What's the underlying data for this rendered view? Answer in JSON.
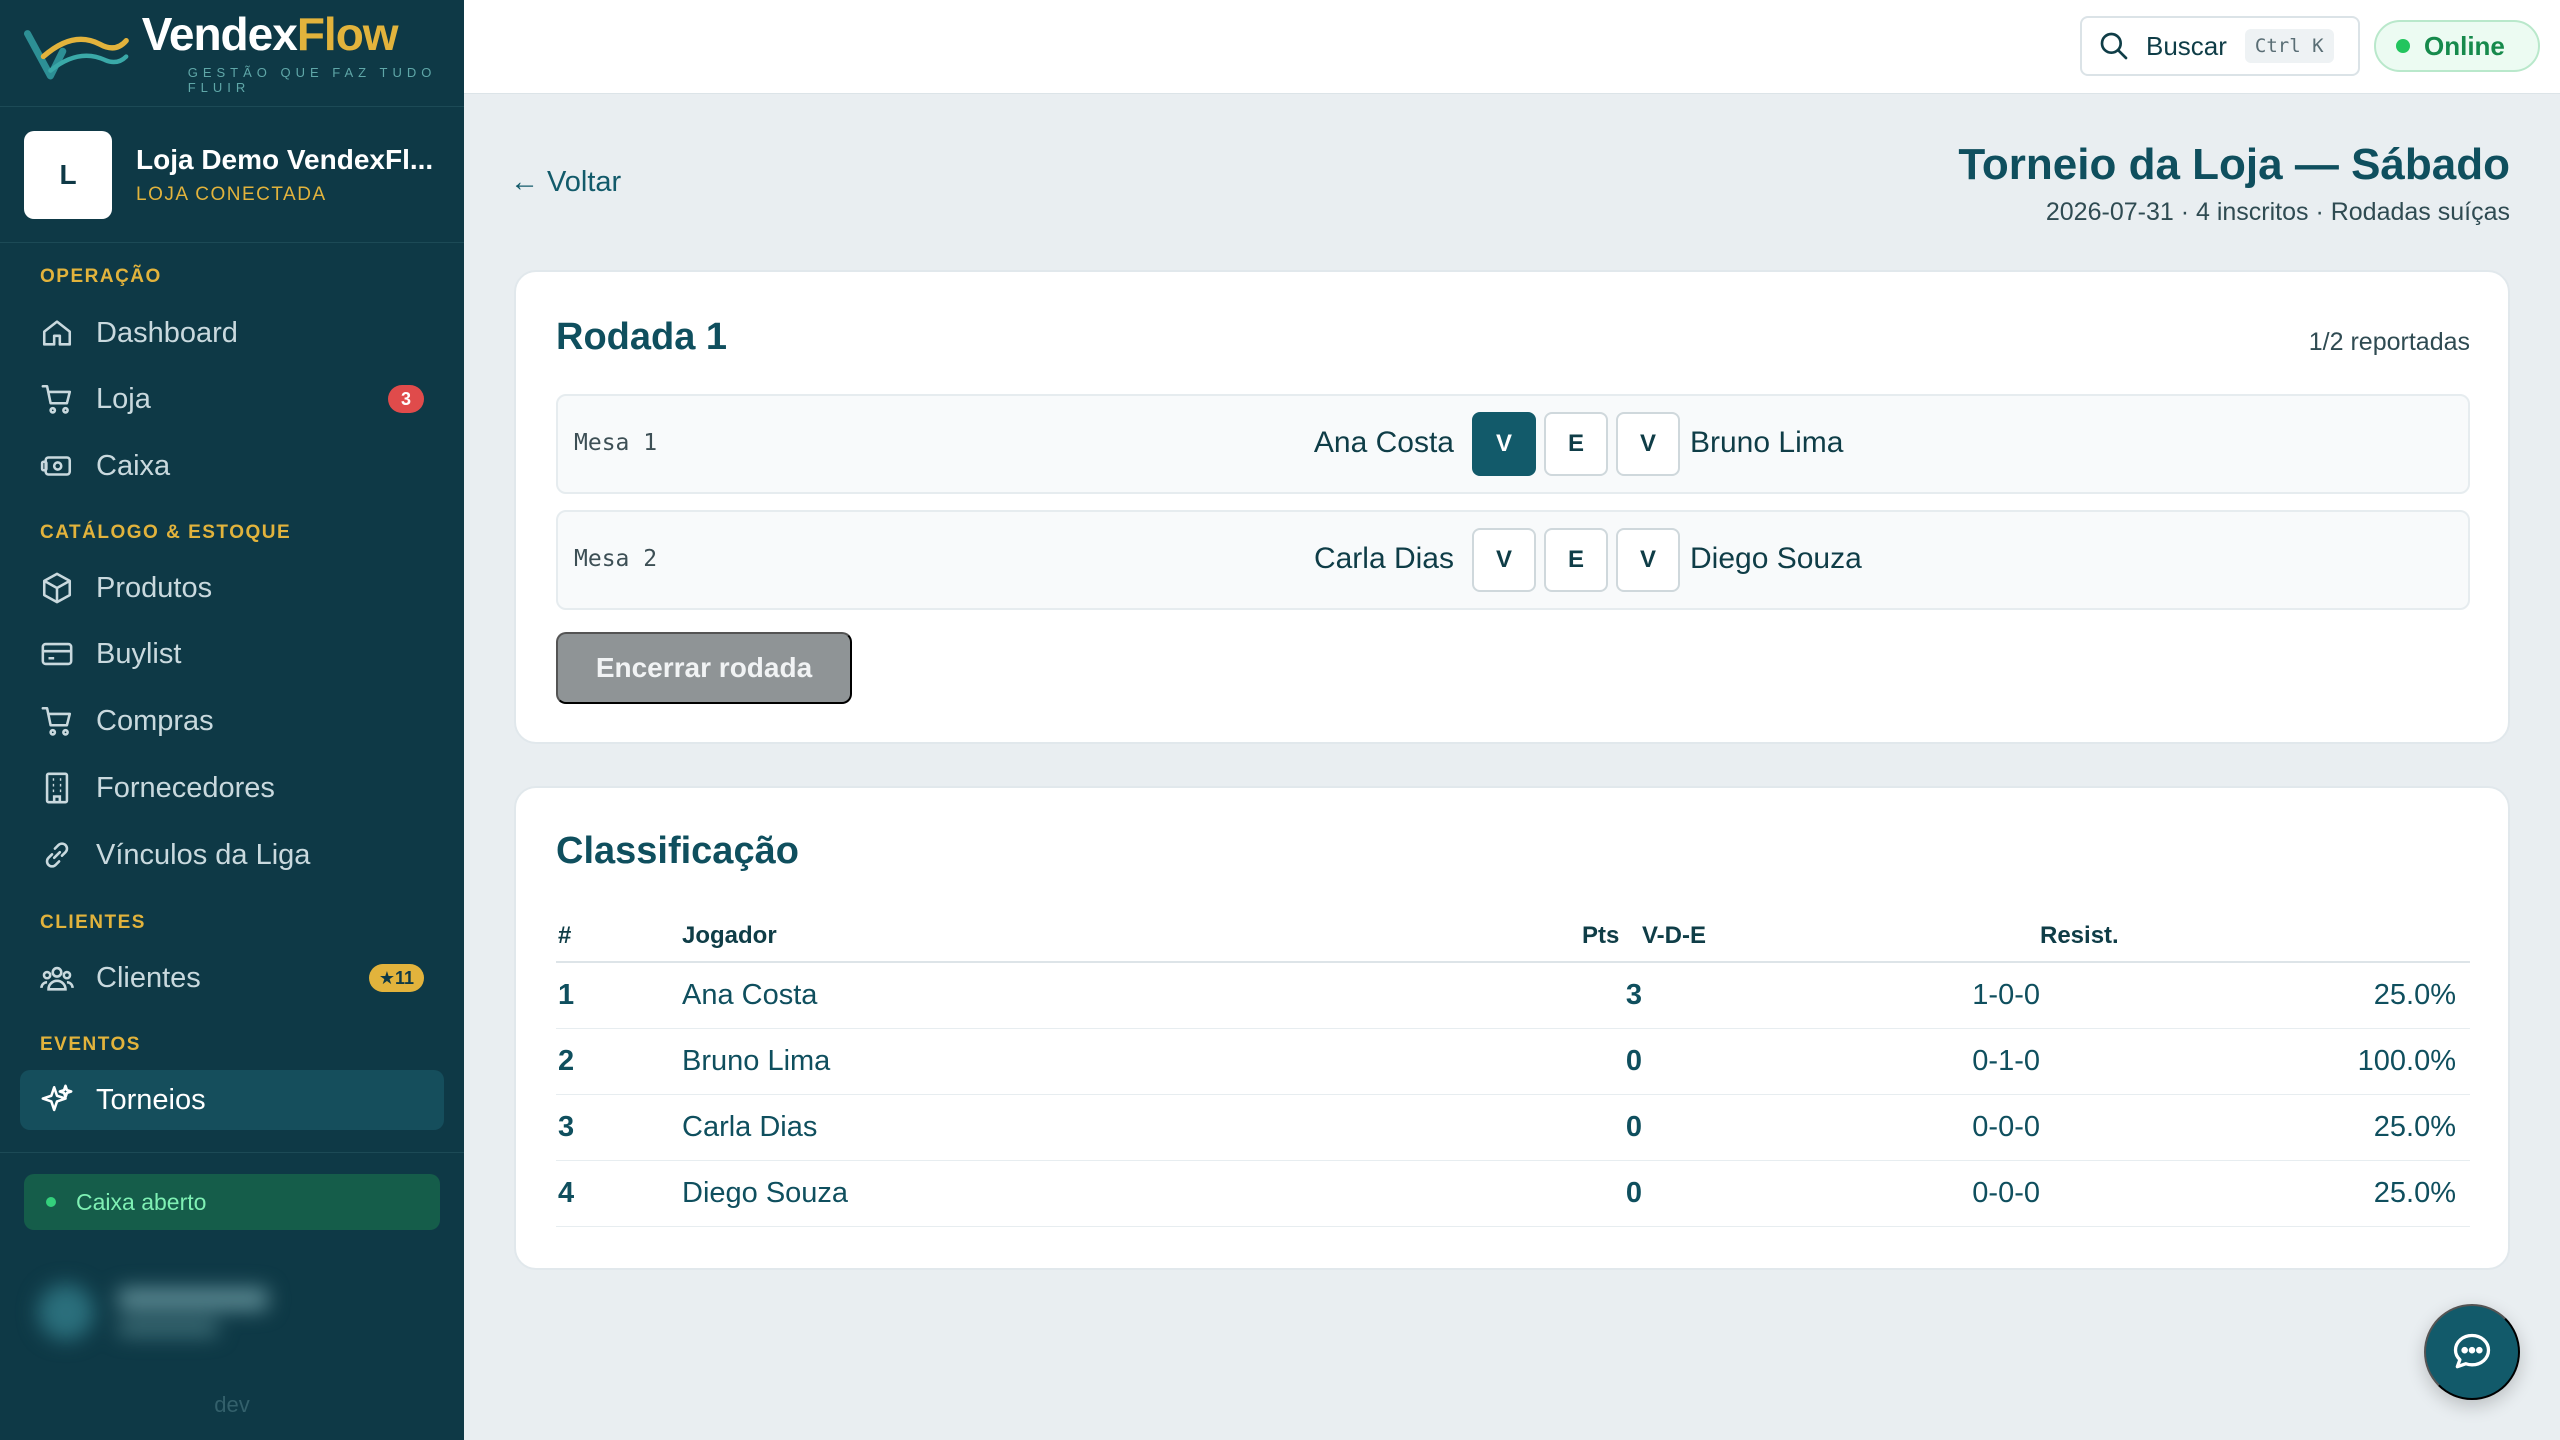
{
  "brand": {
    "name_main": "Vendex",
    "name_accent": "Flow",
    "tagline": "GESTÃO QUE FAZ TUDO FLUIR"
  },
  "store": {
    "initial": "L",
    "name": "Loja Demo VendexFl...",
    "status": "LOJA CONECTADA"
  },
  "nav": {
    "operacao": "OPERAÇÃO",
    "dashboard": "Dashboard",
    "loja": "Loja",
    "loja_badge": "3",
    "caixa": "Caixa",
    "catalogo": "CATÁLOGO & ESTOQUE",
    "produtos": "Produtos",
    "buylist": "Buylist",
    "compras": "Compras",
    "fornecedores": "Fornecedores",
    "vinculos": "Vínculos da Liga",
    "clientes_section": "CLIENTES",
    "clientes": "Clientes",
    "clientes_badge": "★11",
    "eventos": "EVENTOS",
    "torneios": "Torneios"
  },
  "cash_status": "Caixa aberto",
  "env": "dev",
  "topbar": {
    "search_label": "Buscar",
    "search_shortcut": "Ctrl K",
    "status": "Online"
  },
  "page": {
    "back": "← Voltar",
    "title": "Torneio da Loja — Sábado",
    "subtitle": "2026-07-31 · 4 inscritos · Rodadas suíças"
  },
  "round": {
    "title": "Rodada 1",
    "reported": "1/2 reportadas",
    "result_options": [
      "V",
      "E",
      "V"
    ],
    "matches": [
      {
        "table": "Mesa 1",
        "player1": "Ana Costa",
        "player2": "Bruno Lima",
        "selected": 0
      },
      {
        "table": "Mesa 2",
        "player1": "Carla Dias",
        "player2": "Diego Souza",
        "selected": -1
      }
    ],
    "end_button": "Encerrar rodada"
  },
  "standings": {
    "title": "Classificação",
    "headers": {
      "rank": "#",
      "player": "Jogador",
      "pts": "Pts",
      "vde": "V-D-E",
      "resist": "Resist."
    },
    "rows": [
      {
        "rank": "1",
        "player": "Ana Costa",
        "pts": "3",
        "vde": "1-0-0",
        "resist": "25.0%"
      },
      {
        "rank": "2",
        "player": "Bruno Lima",
        "pts": "0",
        "vde": "0-1-0",
        "resist": "100.0%"
      },
      {
        "rank": "3",
        "player": "Carla Dias",
        "pts": "0",
        "vde": "0-0-0",
        "resist": "25.0%"
      },
      {
        "rank": "4",
        "player": "Diego Souza",
        "pts": "0",
        "vde": "0-0-0",
        "resist": "25.0%"
      }
    ]
  },
  "colors": {
    "sidebar": "#0e3946",
    "accent": "#125a6a",
    "gold": "#e2b33c",
    "online": "#22c55e"
  }
}
